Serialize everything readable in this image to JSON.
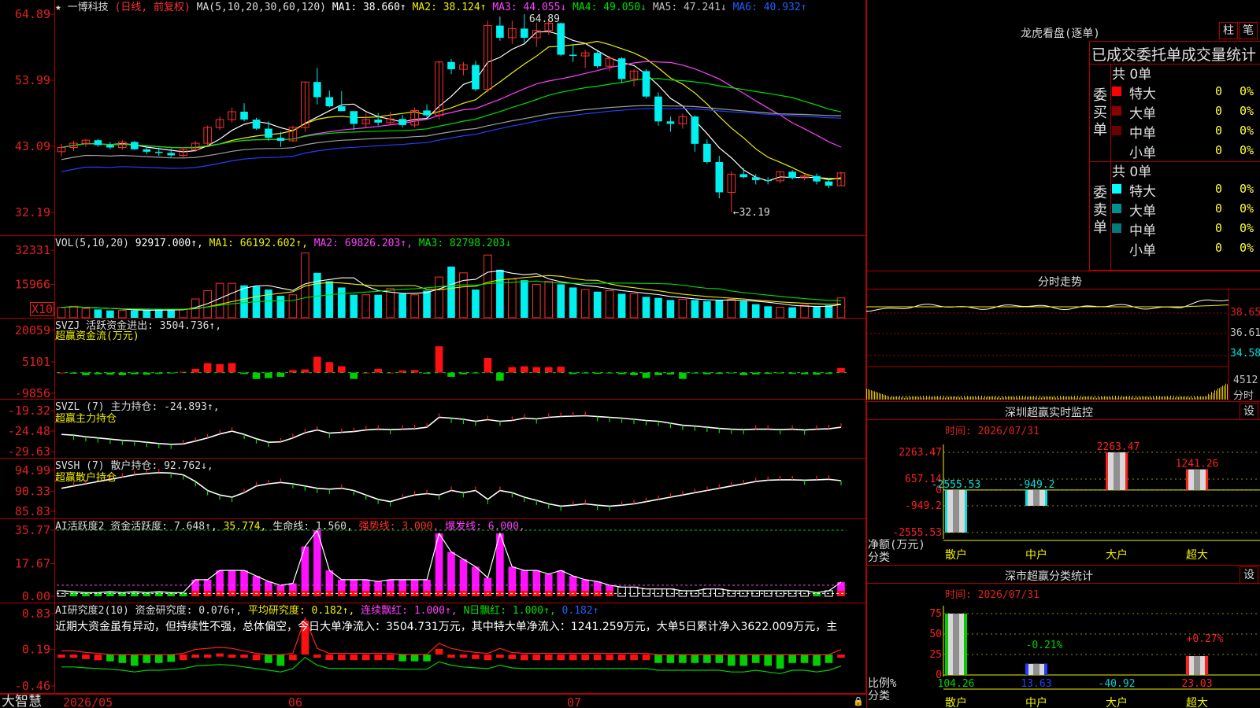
{
  "app": {
    "logo": "大智慧"
  },
  "stock": {
    "star": "★",
    "name": "一博科技",
    "mode": "(日线, 前复权)"
  },
  "colors": {
    "up": "#ff3030",
    "down": "#00f0f0",
    "ma1": "#ffffff",
    "ma2": "#f0f000",
    "ma3": "#ff40ff",
    "ma4": "#00e000",
    "ma5": "#a0a0a0",
    "ma6": "#2040ff",
    "axis": "#e02020",
    "grid": "#b00000"
  },
  "price_panel": {
    "legend": [
      {
        "text": "MA(5,10,20,30,60,120)",
        "color": "#dcdcdc"
      },
      {
        "text": "MA1: 38.660↑",
        "color": "#ffffff"
      },
      {
        "text": "MA2: 38.124↑",
        "color": "#f0f000"
      },
      {
        "text": "MA3: 44.055↓",
        "color": "#ff40ff"
      },
      {
        "text": "MA4: 49.050↓",
        "color": "#00e000"
      },
      {
        "text": "MA5: 47.241↓",
        "color": "#c0c0c0"
      },
      {
        "text": "MA6: 40.932↑",
        "color": "#2060ff"
      }
    ],
    "axis": [
      "64.89",
      "53.99",
      "43.09",
      "32.19"
    ],
    "high_label": "64.89",
    "low_label": "←32.19"
  },
  "vol_panel": {
    "legend": [
      {
        "text": "VOL(5,10,20) ",
        "color": "#dcdcdc"
      },
      {
        "text": "92917.000↑,",
        "color": "#ffffff"
      },
      {
        "text": "MA1: 66192.602↑,",
        "color": "#f0f000"
      },
      {
        "text": "MA2: 69826.203↑,",
        "color": "#ff40ff"
      },
      {
        "text": "MA3: 82798.203↓",
        "color": "#00e000"
      }
    ],
    "axis": [
      "32331",
      "15966"
    ],
    "unit": "X10"
  },
  "svzj_panel": {
    "legend": [
      {
        "text": "SVZJ  活跃资金进出: 3504.736↑,",
        "color": "#dcdcdc"
      }
    ],
    "legend2": "超赢资金流(万元)",
    "axis": [
      "20059",
      "5101",
      "-9856"
    ]
  },
  "svzl_panel": {
    "legend": [
      {
        "text": "SVZL (7) 主力持仓: -24.893↑,",
        "color": "#dcdcdc"
      }
    ],
    "legend2": "超赢主力持仓",
    "axis": [
      "-19.32",
      "-24.48",
      "-29.63"
    ]
  },
  "svsh_panel": {
    "legend": [
      {
        "text": "SVSH (7) 散户持仓: 92.762↓,",
        "color": "#dcdcdc"
      }
    ],
    "legend2": "超赢散户持仓",
    "axis": [
      "94.99",
      "90.33",
      "85.83"
    ]
  },
  "ai_active_panel": {
    "legend": [
      {
        "text": "AI活跃度2 资金活跃度: 7.648↑,",
        "color": "#dcdcdc"
      },
      {
        "text": "35.774,",
        "color": "#f0f000"
      },
      {
        "text": "生命线: 1.560,",
        "color": "#dcdcdc"
      },
      {
        "text": "强势线: 3.000,",
        "color": "#ff3030"
      },
      {
        "text": "爆发线: 6.000,",
        "color": "#ff40ff"
      }
    ],
    "axis": [
      "35.77",
      "17.67",
      "0.00"
    ]
  },
  "ai_research_panel": {
    "legend": [
      {
        "text": "AI研究度2(10) 资金研究度: 0.076↑,",
        "color": "#dcdcdc"
      },
      {
        "text": "平均研究度: 0.182↑,",
        "color": "#f0f000"
      },
      {
        "text": "连续飘红: 1.000↑,",
        "color": "#ff40ff"
      },
      {
        "text": "N日飘红: 1.000↑,",
        "color": "#00e000"
      },
      {
        "text": "0.182↑",
        "color": "#2060ff"
      }
    ],
    "commentary": "近期大资金虽有异动，但持续性不强，总体偏空，今日大单净流入：3504.731万元，其中特大单净流入：1241.259万元，大单5日累计净入3622.009万元，主",
    "axis": [
      "0.83",
      "0.19",
      "-0.46"
    ]
  },
  "date_axis": [
    "2026/05",
    "06",
    "07"
  ],
  "right": {
    "dragon_title": "龙虎看盘(逐单)",
    "btn_bar": "柱",
    "btn_pen": "笔",
    "table_title": "已成交委托单成交量统计",
    "buy_label": "委买单",
    "sell_label": "委卖单",
    "buy_total": "共 0单",
    "sell_total": "共 0单",
    "buy_rows": [
      {
        "name": "特大",
        "val": "0",
        "pct": "0%",
        "color": "#ff0000"
      },
      {
        "name": "大单",
        "val": "0",
        "pct": "0%",
        "color": "#8b0000"
      },
      {
        "name": "中单",
        "val": "0",
        "pct": "0%",
        "color": "#6a0000"
      },
      {
        "name": "小单",
        "val": "0",
        "pct": "0%",
        "color": "#000000"
      }
    ],
    "sell_rows": [
      {
        "name": "特大",
        "val": "0",
        "pct": "0%",
        "color": "#00ffff"
      },
      {
        "name": "大单",
        "val": "0",
        "pct": "0%",
        "color": "#009090"
      },
      {
        "name": "中单",
        "val": "0",
        "pct": "0%",
        "color": "#007a7a"
      },
      {
        "name": "小单",
        "val": "0",
        "pct": "0%",
        "color": "#000000"
      }
    ],
    "intraday_title": "分时走势",
    "intraday_axis": [
      "38.65",
      "36.61",
      "34.58"
    ],
    "intraday_vol": "4512",
    "intraday_vol_label": "分时",
    "monitor_title": "深圳超赢实时监控",
    "monitor_btn": "设",
    "monitor_time": "时间: 2026/07/31",
    "monitor_axis": [
      "2263.47",
      "657.14",
      "0",
      "-949.2",
      "-2555.53"
    ],
    "monitor_ylabel": "净额(万元)",
    "monitor_xlabel": "分类",
    "monitor_cats": [
      "散户",
      "中户",
      "大户",
      "超大"
    ],
    "monitor_bar_labels": [
      "-2555.53",
      "-949.2",
      "2263.47",
      "1241.26"
    ],
    "stat_title": "深市超赢分类统计",
    "stat_btn": "设",
    "stat_time": "时间: 2026/07/31",
    "stat_axis": [
      "75",
      "50",
      "25",
      "0"
    ],
    "stat_ylabel": "比例%",
    "stat_xlabel": "分类",
    "stat_cats": [
      "散户",
      "中户",
      "大户",
      "超大"
    ],
    "stat_values": [
      "104.26",
      "13.63",
      "-40.92",
      "23.03"
    ],
    "stat_bar_labels": [
      "-0.21%",
      "+0.27%"
    ]
  },
  "chart_data": [
    {
      "type": "candlestick",
      "title": "一博科技 (日线, 前复权)",
      "ylim": [
        32.19,
        64.89
      ],
      "y_ticks": [
        64.89,
        53.99,
        43.09,
        32.19
      ],
      "x_ticks": [
        "2026/05",
        "06",
        "07"
      ],
      "ohlc": [
        [
          42.2,
          43.5,
          41.4,
          42.9
        ],
        [
          42.9,
          44.0,
          42.3,
          43.6
        ],
        [
          43.6,
          44.3,
          43.0,
          44.1
        ],
        [
          44.1,
          44.3,
          43.0,
          43.3
        ],
        [
          43.3,
          43.8,
          42.6,
          42.9
        ],
        [
          42.9,
          44.1,
          42.5,
          43.8
        ],
        [
          43.8,
          44.0,
          42.5,
          42.6
        ],
        [
          42.6,
          43.0,
          41.8,
          42.2
        ],
        [
          42.2,
          42.9,
          41.5,
          42.0
        ],
        [
          42.0,
          42.7,
          41.3,
          41.6
        ],
        [
          41.6,
          43.0,
          41.2,
          42.5
        ],
        [
          42.5,
          44.0,
          42.2,
          43.6
        ],
        [
          43.6,
          46.5,
          43.2,
          46.2
        ],
        [
          46.2,
          48.0,
          45.8,
          47.5
        ],
        [
          47.5,
          49.5,
          47.0,
          48.8
        ],
        [
          48.8,
          50.2,
          47.2,
          47.5
        ],
        [
          47.5,
          47.8,
          45.8,
          46.0
        ],
        [
          46.0,
          47.2,
          44.0,
          44.5
        ],
        [
          44.5,
          45.5,
          43.0,
          44.0
        ],
        [
          44.0,
          46.5,
          43.8,
          46.2
        ],
        [
          46.2,
          53.7,
          45.5,
          53.7
        ],
        [
          53.7,
          56.0,
          50.0,
          51.2
        ],
        [
          51.2,
          52.3,
          49.5,
          49.7
        ],
        [
          49.7,
          52.2,
          49.2,
          48.9
        ],
        [
          48.9,
          48.8,
          45.8,
          46.8
        ],
        [
          46.8,
          48.5,
          46.2,
          47.5
        ],
        [
          47.5,
          48.6,
          46.5,
          47.0
        ],
        [
          47.0,
          48.8,
          46.5,
          47.6
        ],
        [
          47.6,
          48.3,
          46.2,
          46.6
        ],
        [
          46.6,
          49.5,
          46.2,
          49.0
        ],
        [
          49.0,
          50.0,
          47.8,
          48.2
        ],
        [
          48.2,
          57.2,
          47.5,
          57.0
        ],
        [
          57.0,
          57.5,
          55.0,
          55.8
        ],
        [
          55.8,
          57.0,
          54.8,
          56.5
        ],
        [
          56.5,
          57.2,
          52.2,
          52.5
        ],
        [
          52.5,
          63.8,
          52.0,
          63.0
        ],
        [
          63.0,
          64.5,
          60.5,
          61.0
        ],
        [
          61.0,
          63.8,
          60.0,
          62.5
        ],
        [
          62.5,
          64.89,
          60.2,
          61.0
        ],
        [
          61.0,
          63.5,
          59.5,
          62.2
        ],
        [
          62.2,
          64.0,
          61.5,
          63.4
        ],
        [
          63.4,
          63.5,
          58.0,
          58.2
        ],
        [
          58.2,
          60.0,
          57.0,
          58.0
        ],
        [
          58.0,
          59.0,
          56.0,
          58.5
        ],
        [
          58.5,
          58.8,
          56.0,
          56.3
        ],
        [
          56.3,
          58.0,
          55.5,
          57.6
        ],
        [
          57.6,
          57.8,
          53.5,
          54.2
        ],
        [
          54.2,
          55.8,
          53.0,
          55.5
        ],
        [
          55.5,
          55.8,
          51.0,
          51.3
        ],
        [
          51.3,
          52.0,
          46.5,
          47.2
        ],
        [
          47.2,
          48.0,
          45.5,
          46.8
        ],
        [
          46.8,
          48.5,
          46.0,
          48.0
        ],
        [
          48.0,
          48.2,
          42.2,
          43.5
        ],
        [
          43.5,
          44.2,
          40.2,
          40.5
        ],
        [
          40.5,
          41.5,
          34.5,
          35.5
        ],
        [
          35.5,
          39.0,
          32.19,
          38.5
        ],
        [
          38.5,
          39.5,
          37.8,
          38.0
        ],
        [
          38.0,
          38.5,
          36.8,
          37.5
        ],
        [
          37.5,
          38.0,
          36.8,
          37.4
        ],
        [
          37.4,
          39.0,
          37.0,
          38.9
        ],
        [
          38.9,
          39.2,
          37.6,
          37.9
        ],
        [
          37.9,
          38.4,
          37.5,
          38.2
        ],
        [
          38.2,
          38.6,
          36.8,
          37.3
        ],
        [
          37.3,
          37.9,
          36.2,
          36.6
        ],
        [
          36.6,
          38.9,
          36.5,
          38.7
        ]
      ]
    },
    {
      "type": "bar",
      "title": "VOL(5,10,20)",
      "ylim": [
        0,
        32331
      ],
      "y_ticks": [
        32331,
        15966
      ],
      "values": [
        5000,
        5500,
        4500,
        4000,
        3500,
        3500,
        3500,
        3800,
        4000,
        3800,
        4000,
        9000,
        13000,
        16500,
        16500,
        15500,
        15000,
        13500,
        10500,
        11000,
        31000,
        21500,
        17500,
        14500,
        11000,
        11000,
        11000,
        14000,
        11500,
        11000,
        13000,
        19500,
        24500,
        21500,
        13500,
        30000,
        23000,
        18500,
        18000,
        16000,
        17500,
        16000,
        14500,
        13500,
        12500,
        13000,
        11500,
        11500,
        10000,
        9500,
        8500,
        8800,
        8500,
        8000,
        8500,
        8800,
        8000,
        6500,
        5500,
        5000,
        5000,
        6000,
        5500,
        6000,
        9500
      ]
    },
    {
      "type": "bar",
      "title": "SVZJ 活跃资金进出",
      "ylim": [
        -9856,
        20059
      ],
      "y_ticks": [
        20059,
        5101,
        -9856
      ],
      "values": [
        0,
        -500,
        -1200,
        -800,
        -1000,
        -1200,
        -800,
        -1000,
        -600,
        -400,
        400,
        1800,
        4500,
        4000,
        4500,
        -700,
        -3000,
        -2600,
        -2000,
        1200,
        1500,
        7500,
        5000,
        3000,
        -3000,
        0,
        1800,
        0,
        1000,
        1200,
        -500,
        12500,
        -2000,
        -800,
        -200,
        7000,
        -3800,
        2600,
        3000,
        2600,
        2600,
        2800,
        -700,
        -400,
        -600,
        -300,
        -800,
        -1200,
        -2600,
        -1200,
        -900,
        -3000,
        -400,
        -800,
        -600,
        -200,
        -1200,
        -900,
        -600,
        -400,
        -600,
        -800,
        -1000,
        -600,
        2200
      ]
    },
    {
      "type": "line",
      "title": "SVZL (7) 主力持仓",
      "ylim": [
        -29.63,
        -19.32
      ],
      "y_ticks": [
        -19.32,
        -24.48,
        -29.63
      ],
      "values": [
        -25.3,
        -25.5,
        -25.9,
        -26.2,
        -26.5,
        -26.8,
        -27.0,
        -27.3,
        -27.6,
        -27.8,
        -27.7,
        -27.0,
        -26.2,
        -25.2,
        -24.5,
        -25.3,
        -26.4,
        -27.3,
        -27.2,
        -26.2,
        -24.9,
        -24.2,
        -25.0,
        -24.8,
        -24.6,
        -24.2,
        -24.0,
        -24.1,
        -24.0,
        -23.9,
        -23.5,
        -21.0,
        -21.2,
        -21.5,
        -22.0,
        -21.6,
        -22.0,
        -21.8,
        -21.2,
        -21.4,
        -21.0,
        -20.8,
        -20.7,
        -20.6,
        -20.8,
        -21.0,
        -21.2,
        -21.5,
        -21.8,
        -22.0,
        -22.5,
        -23.0,
        -23.2,
        -23.5,
        -23.8,
        -24.0,
        -24.1,
        -24.0,
        -24.0,
        -24.1,
        -24.0,
        -24.2,
        -24.0,
        -23.9,
        -23.5
      ]
    },
    {
      "type": "line",
      "title": "SVSH (7) 散户持仓",
      "ylim": [
        85.83,
        94.99
      ],
      "y_ticks": [
        94.99,
        90.33,
        85.83
      ],
      "values": [
        91.0,
        91.5,
        92.0,
        92.5,
        93.0,
        93.5,
        94.0,
        94.3,
        94.5,
        94.4,
        94.0,
        92.5,
        90.5,
        89.5,
        89.0,
        90.0,
        91.5,
        92.0,
        92.3,
        92.0,
        91.5,
        91.0,
        90.8,
        91.0,
        90.5,
        89.5,
        88.5,
        88.0,
        88.8,
        89.5,
        89.8,
        89.5,
        90.5,
        90.0,
        90.5,
        88.5,
        90.5,
        90.0,
        89.0,
        88.3,
        87.5,
        87.0,
        87.2,
        87.5,
        87.2,
        87.0,
        87.2,
        87.5,
        88.0,
        88.5,
        89.0,
        89.5,
        90.0,
        90.5,
        91.0,
        91.5,
        92.0,
        92.5,
        92.8,
        92.9,
        92.9,
        92.8,
        92.9,
        93.0,
        92.7
      ]
    },
    {
      "type": "bar",
      "title": "AI活跃度2 资金活跃度",
      "ylim": [
        0,
        35.77
      ],
      "y_ticks": [
        35.77,
        17.67,
        0.0
      ],
      "values": [
        3,
        2.5,
        2,
        2,
        2.5,
        2,
        2.5,
        2,
        2.5,
        2,
        2,
        9,
        9,
        14,
        14,
        14,
        11,
        8,
        6,
        7,
        27,
        35.77,
        14,
        9,
        9,
        9,
        8,
        9,
        9,
        9,
        9,
        34,
        24,
        20,
        16,
        10,
        34,
        16,
        14,
        14,
        12,
        14,
        11,
        9,
        8,
        6,
        5,
        5,
        4,
        4,
        4,
        3,
        3,
        4,
        4,
        3,
        3,
        3,
        3,
        3,
        3,
        3,
        2,
        3,
        7.648
      ]
    },
    {
      "type": "bar",
      "title": "AI研究度2(10) 资金研究度",
      "ylim": [
        -0.46,
        0.83
      ],
      "y_ticks": [
        0.83,
        0.19,
        -0.46
      ],
      "values": [
        0.05,
        0.05,
        0.02,
        0.0,
        -0.02,
        -0.05,
        -0.1,
        -0.05,
        -0.05,
        -0.03,
        0.0,
        0.08,
        0.1,
        0.12,
        0.1,
        0.05,
        0.0,
        -0.05,
        -0.1,
        0.0,
        0.7,
        0.1,
        0.0,
        0.0,
        0.0,
        0.0,
        0.0,
        0.0,
        -0.02,
        -0.02,
        -0.02,
        0.2,
        0.1,
        0.05,
        0.02,
        0.0,
        0.1,
        0.02,
        0.0,
        0.0,
        0.0,
        0.0,
        0.0,
        0.0,
        0.0,
        0.0,
        0.0,
        0.0,
        0.0,
        -0.05,
        -0.05,
        -0.05,
        -0.05,
        -0.05,
        -0.05,
        -0.1,
        -0.1,
        -0.05,
        -0.1,
        -0.15,
        -0.05,
        -0.05,
        -0.1,
        -0.05,
        0.076
      ]
    },
    {
      "type": "bar",
      "title": "深圳超赢实时监控",
      "categories": [
        "散户",
        "中户",
        "大户",
        "超大"
      ],
      "values": [
        -2555.53,
        -949.2,
        2263.47,
        1241.26
      ],
      "ylabel": "净额(万元)",
      "xlabel": "分类",
      "ylim": [
        -2555.53,
        2263.47
      ]
    },
    {
      "type": "bar",
      "title": "深市超赢分类统计",
      "categories": [
        "散户",
        "中户",
        "大户",
        "超大"
      ],
      "values": [
        104.26,
        13.63,
        -40.92,
        23.03
      ],
      "ylabel": "比例%",
      "xlabel": "分类",
      "ylim": [
        0,
        75
      ]
    }
  ]
}
